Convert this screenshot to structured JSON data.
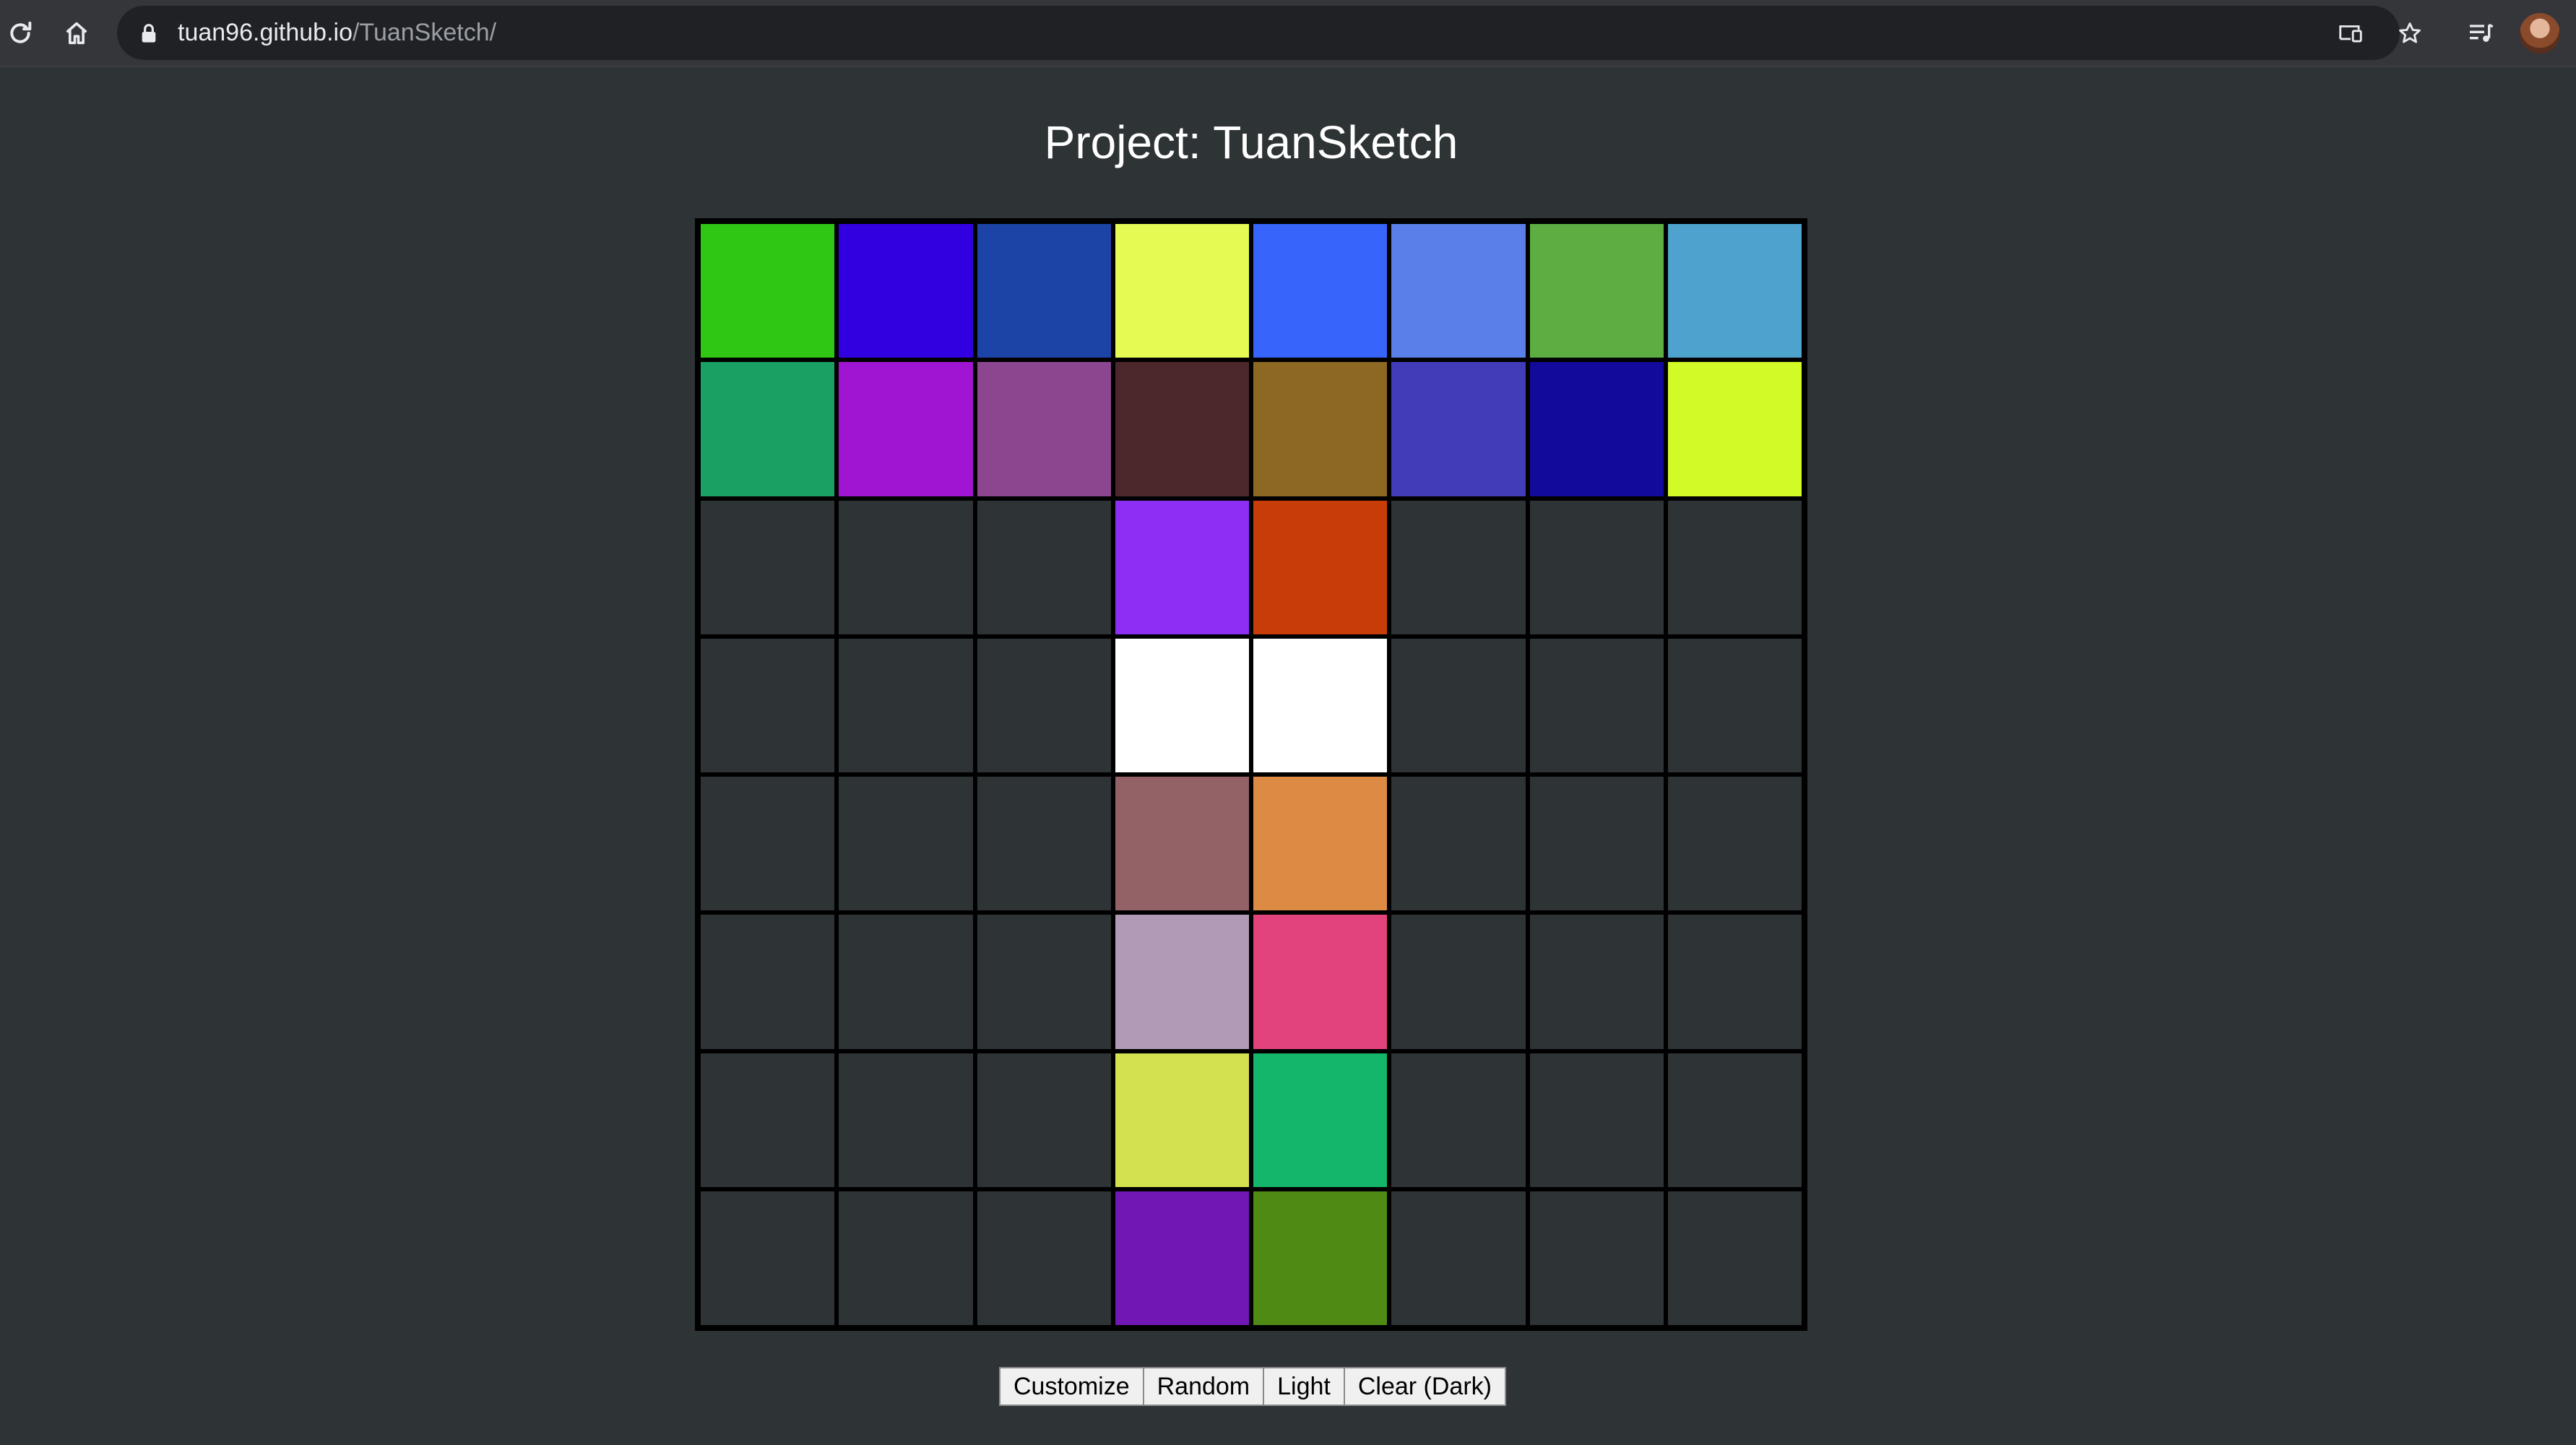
{
  "browser": {
    "url_host": "tuan96.github.io",
    "url_path": "/TuanSketch/",
    "icons": [
      "reload-icon",
      "home-icon",
      "lock-icon",
      "cast-icon",
      "star-icon",
      "media-queue-icon",
      "avatar"
    ]
  },
  "page": {
    "title": "Project: TuanSketch"
  },
  "grid": {
    "rows": 8,
    "columns": 8,
    "empty_color": "#2e3336",
    "cells": [
      [
        "#2fc614",
        "#3200e0",
        "#1c44a6",
        "#e5fb54",
        "#3764fb",
        "#5b7fe9",
        "#5cae43",
        "#4da3cd"
      ],
      [
        "#1ba064",
        "#a015d2",
        "#8c4690",
        "#4c282c",
        "#8c6822",
        "#423cb8",
        "#120a9b",
        "#d2fa26"
      ],
      [
        null,
        null,
        null,
        "#8e2ef5",
        "#c83c08",
        null,
        null,
        null
      ],
      [
        null,
        null,
        null,
        "#ffffff",
        "#ffffff",
        null,
        null,
        null
      ],
      [
        null,
        null,
        null,
        "#926267",
        "#dd8a45",
        null,
        null,
        null
      ],
      [
        null,
        null,
        null,
        "#b09ab6",
        "#e3437c",
        null,
        null,
        null
      ],
      [
        null,
        null,
        null,
        "#d2e14f",
        "#14b66b",
        null,
        null,
        null
      ],
      [
        null,
        null,
        null,
        "#7117b4",
        "#4f8a14",
        null,
        null,
        null
      ]
    ]
  },
  "controls": {
    "customize": "Customize",
    "random": "Random",
    "light": "Light",
    "clear": "Clear (Dark)"
  }
}
